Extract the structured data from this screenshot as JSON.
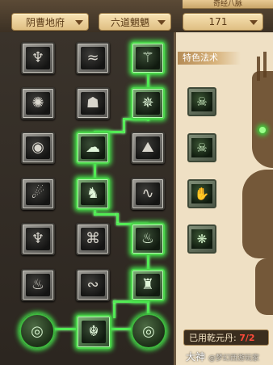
{
  "header": {
    "tab_label": "奇经八脉",
    "dropdowns": [
      {
        "value": "阴曹地府"
      },
      {
        "value": "六道魍魉"
      },
      {
        "value": "171"
      }
    ]
  },
  "tree": {
    "rows": [
      [
        "gh-bird",
        "gh-wave",
        "gh-runner"
      ],
      [
        "gh-claw",
        "gh-mask",
        "gh-wheel"
      ],
      [
        "gh-eye",
        "gh-cloud",
        "gh-mountain"
      ],
      [
        "gh-spirit",
        "gh-beast",
        "gh-swirl"
      ],
      [
        "gh-trident",
        "gh-knot",
        "gh-flame"
      ],
      [
        "gh-fire",
        "gh-serpent",
        "gh-throne"
      ],
      [
        "gh-orb",
        "gh-demon",
        "gh-orb2"
      ]
    ],
    "glyphs": {
      "gh-bird": "♆",
      "gh-wave": "≈",
      "gh-runner": "⚚",
      "gh-claw": "✺",
      "gh-mask": "☗",
      "gh-wheel": "✵",
      "gh-eye": "◉",
      "gh-cloud": "☁",
      "gh-mountain": "⛰",
      "gh-spirit": "☄",
      "gh-beast": "♞",
      "gh-swirl": "∿",
      "gh-trident": "♆",
      "gh-knot": "⌘",
      "gh-flame": "♨",
      "gh-fire": "♨",
      "gh-serpent": "∾",
      "gh-throne": "♜",
      "gh-orb": "◎",
      "gh-demon": "☬",
      "gh-orb2": "◎"
    }
  },
  "special": {
    "title": "特色法术",
    "glyphs": [
      "☠",
      "☠",
      "✋",
      "❋"
    ]
  },
  "footer": {
    "used_label": "已用乾元丹:",
    "used_count": "7/2"
  },
  "watermark": {
    "main": "大神",
    "sub": "@梦幻西游玩家"
  }
}
